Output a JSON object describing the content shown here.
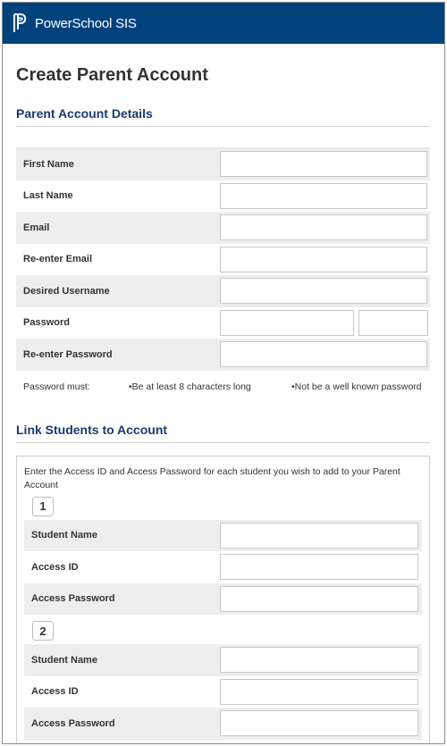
{
  "header": {
    "brand": "PowerSchool SIS",
    "logo_icon": "powerschool-logo-icon",
    "bg_color": "#00427c"
  },
  "page": {
    "title": "Create Parent Account"
  },
  "details": {
    "section_title": "Parent Account Details",
    "fields": [
      {
        "label": "First Name",
        "value": ""
      },
      {
        "label": "Last Name",
        "value": ""
      },
      {
        "label": "Email",
        "value": ""
      },
      {
        "label": "Re-enter Email",
        "value": ""
      },
      {
        "label": "Desired Username",
        "value": ""
      },
      {
        "label": "Password",
        "value": ""
      },
      {
        "label": "Re-enter Password",
        "value": ""
      }
    ],
    "password_rules": {
      "intro": "Password must:",
      "rule1": "•Be at least 8 characters long",
      "rule2": "•Not be a well known password"
    }
  },
  "link": {
    "section_title": "Link Students to Account",
    "intro": "Enter the Access ID and Access Password for each student you wish to add to your Parent Account",
    "students": [
      {
        "number": "1",
        "fields": [
          {
            "label": "Student Name",
            "value": ""
          },
          {
            "label": "Access ID",
            "value": ""
          },
          {
            "label": "Access Password",
            "value": ""
          }
        ]
      },
      {
        "number": "2",
        "fields": [
          {
            "label": "Student Name",
            "value": ""
          },
          {
            "label": "Access ID",
            "value": ""
          },
          {
            "label": "Access Password",
            "value": ""
          }
        ]
      }
    ]
  }
}
